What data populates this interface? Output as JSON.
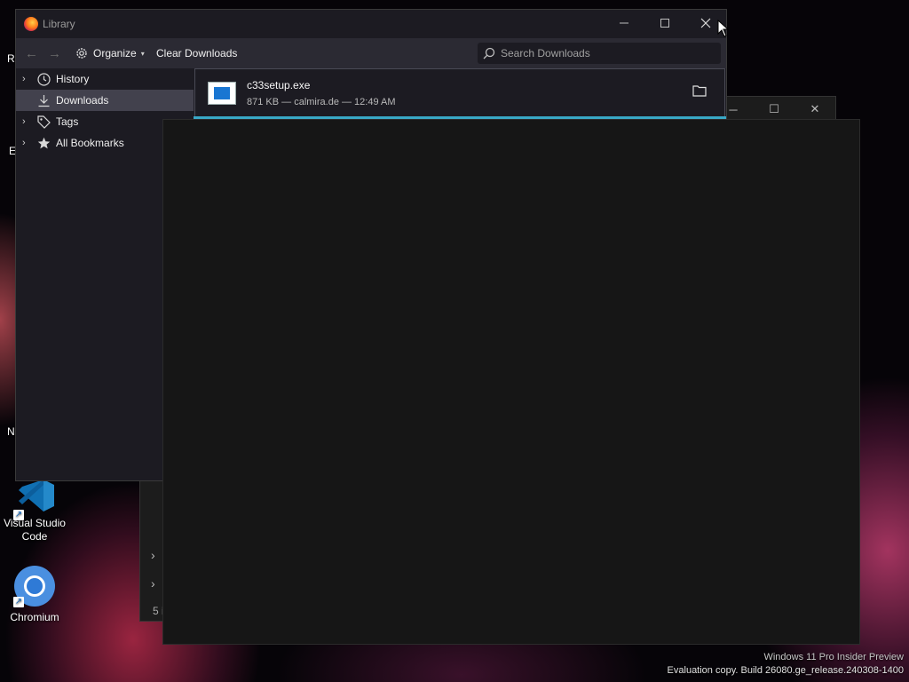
{
  "desktop": {
    "icons": [
      {
        "label": "Visual Studio\nCode",
        "icon": "vscode-icon"
      },
      {
        "label": "Chromium",
        "icon": "chromium-icon"
      }
    ],
    "edge_letters": [
      "R",
      "E",
      "N"
    ]
  },
  "bg_window": {
    "status_count": "5 i"
  },
  "library": {
    "title": "Library",
    "toolbar": {
      "organize_label": "Organize",
      "clear_label": "Clear Downloads",
      "search_placeholder": "Search Downloads"
    },
    "sidebar": [
      {
        "label": "History",
        "icon": "clock-icon",
        "expandable": true,
        "selected": false
      },
      {
        "label": "Downloads",
        "icon": "download-icon",
        "expandable": false,
        "selected": true
      },
      {
        "label": "Tags",
        "icon": "tag-icon",
        "expandable": true,
        "selected": false
      },
      {
        "label": "All Bookmarks",
        "icon": "star-icon",
        "expandable": true,
        "selected": false
      }
    ],
    "downloads": [
      {
        "filename": "c33setup.exe",
        "meta": "871 KB — calmira.de — 12:49 AM"
      }
    ]
  },
  "watermark": {
    "line1": "Windows 11 Pro Insider Preview",
    "line2": "Evaluation copy. Build 26080.ge_release.240308-1400"
  },
  "colors": {
    "accent_progress": "#39a8c6",
    "selected_bg": "#42414d",
    "toolbar_bg": "#2b2a33",
    "window_bg": "#1c1b22"
  }
}
